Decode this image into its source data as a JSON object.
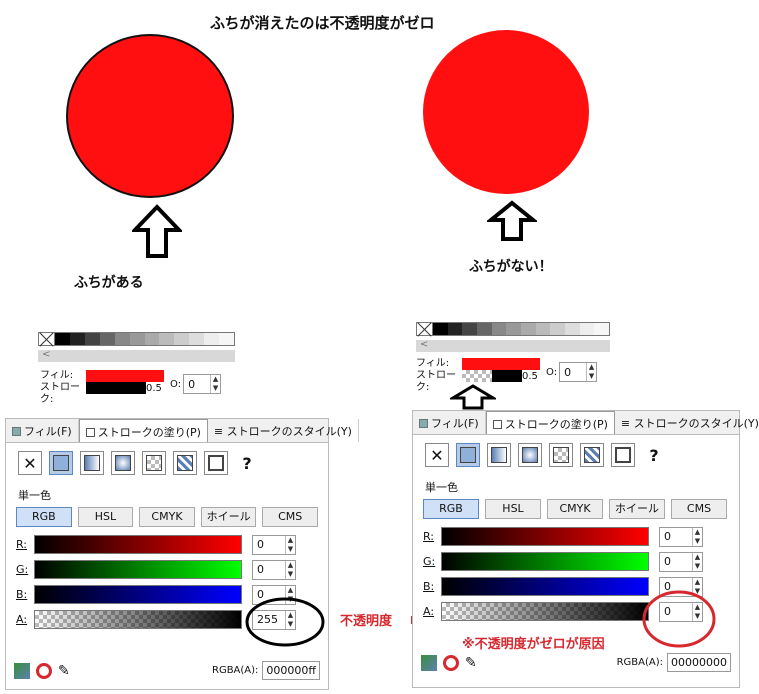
{
  "title": "ふちが消えたのは不透明度がゼロ",
  "left_caption": "ふちがある",
  "right_caption": "ふちがない！",
  "opacity_label": "不透明度",
  "cause_note": "※不透明度がゼロが原因",
  "colors": {
    "fill": "#ff0f0f",
    "annotation": "#d7282f",
    "selected": "#b5cbe8"
  },
  "palette_left": {
    "fill_label": "フィル:",
    "stroke_label": "ストローク:",
    "stroke_width": "0.5",
    "o_label": "O:",
    "o_value": "0"
  },
  "palette_right": {
    "fill_label": "フィル:",
    "stroke_label": "ストローク:",
    "stroke_width": "0.5",
    "o_label": "O:",
    "o_value": "0"
  },
  "dialog": {
    "tabs": [
      "フィル(F)",
      "ストロークの塗り(P)",
      "ストロークのスタイル(Y)"
    ],
    "mode_label": "単一色",
    "modes": [
      "RGB",
      "HSL",
      "CMYK",
      "ホイール",
      "CMS"
    ],
    "channels": [
      "R:",
      "G:",
      "B:",
      "A:"
    ],
    "rgba_label": "RGBA(A):"
  },
  "dialog_left": {
    "values": [
      "0",
      "0",
      "0",
      "255"
    ],
    "rgba": "000000ff"
  },
  "dialog_right": {
    "values": [
      "0",
      "0",
      "0",
      "0"
    ],
    "rgba": "00000000"
  }
}
